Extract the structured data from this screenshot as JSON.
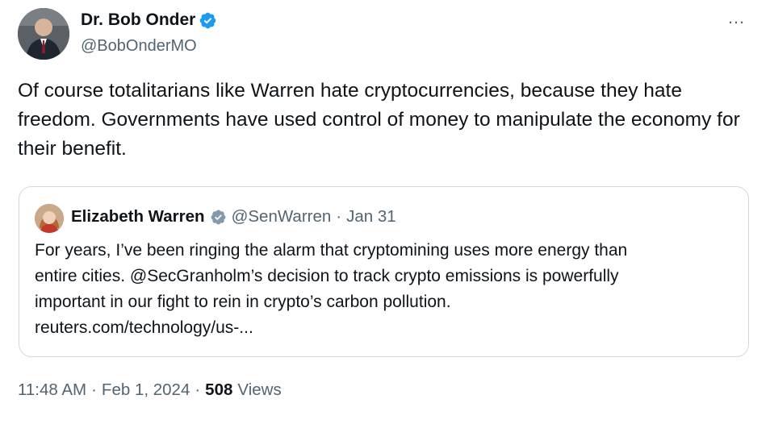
{
  "author": {
    "name": "Dr. Bob Onder",
    "handle": "@BobOnderMO"
  },
  "more_icon": "…",
  "tweet": {
    "text": "Of course totalitarians like Warren hate cryptocurrencies, because they hate freedom. Governments have used control of money to manipulate the economy for their benefit."
  },
  "quote": {
    "name": "Elizabeth Warren",
    "handle": "@SenWarren",
    "separator": "·",
    "date": "Jan 31",
    "text_line1": "For years, I’ve been ringing the alarm that cryptomining uses more energy than",
    "text_line2": "entire cities. @SecGranholm’s decision to track crypto emissions is powerfully",
    "text_line3": "important in our fight to rein in crypto’s carbon pollution.",
    "link": "reuters.com/technology/us-..."
  },
  "meta": {
    "time": "11:48 AM",
    "separator": "·",
    "date": "Feb 1, 2024",
    "views_count": "508",
    "views_label": "Views"
  },
  "colors": {
    "verified": "#1d9bf0",
    "secondary_text": "#536471",
    "border": "#cfd9de"
  }
}
